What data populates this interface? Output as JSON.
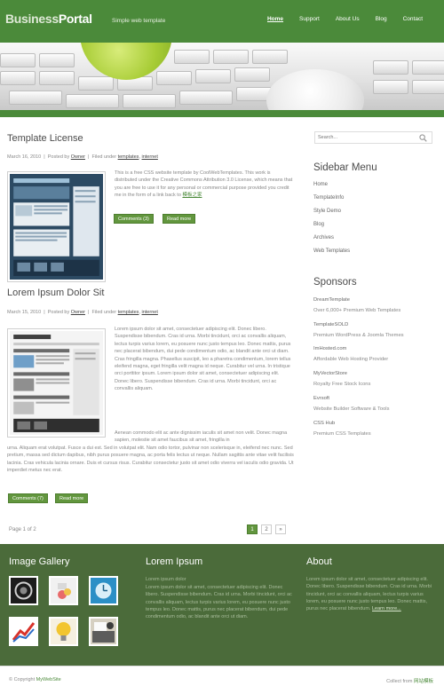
{
  "header": {
    "logo_part1": "Business",
    "logo_part2": "Portal",
    "tagline": "Simple web template",
    "nav": [
      "Home",
      "Support",
      "About Us",
      "Blog",
      "Contact"
    ]
  },
  "posts": [
    {
      "title": "Template License",
      "meta_date": "March 16, 2010",
      "meta_posted_by": "Posted by",
      "meta_author": "Owner",
      "meta_filed": "Filed under",
      "meta_tag1": "templates",
      "meta_tag2": "internet",
      "text": "This is a free CSS website template by CoolWebTemplates. This work is distributed under the Creative Commons Attribution 3.0 License, which means that you are free to use it for any personal or commercial purpose provided you credit me in the form of a link back to",
      "text_link": "模板之家",
      "comments_label": "Comments (3)",
      "readmore_label": "Read more"
    },
    {
      "title": "Lorem Ipsum Dolor Sit",
      "meta_date": "March 15, 2010",
      "meta_posted_by": "Posted by",
      "meta_author": "Owner",
      "meta_filed": "Filed under",
      "meta_tag1": "templates",
      "meta_tag2": "internet",
      "para1": "Lorem ipsum dolor sit amet, consectetuer adipiscing elit. Donec libero. Suspendisse bibendum. Cras id urna. Morbi tincidunt, orci ac convallis aliquam, lectus turpis varius lorem, eu posuere nunc justo tempus leo. Donec mattis, purus nec placerat bibendum, dui pede condimentum odio, ac blandit ante orci ut diam. Cras fringilla magna. Phasellus suscipit, leo a pharetra condimentum, lorem tellus eleifend magna, eget fringilla velit magna id neque. Curabitur vel urna. In tristique orci porttitor ipsum. Lorem ipsum dolor sit amet, consectetuer adipiscing elit. Donec libero. Suspendisse bibendum. Cras id urna. Morbi tincidunt, orci ac convallis aliquam.",
      "para2_a": "Aenean commodo elit ac ante dignissim iaculis sit amet non velit. Donec magna sapien, molestie sit amet faucibus sit amet, fringilla in",
      "para2_b": "urna. Aliquam erat volutpat. Fusce a dui est. Sed in volutpat elit. Nam odio tortor, pulvinar non scelerisque in, eleifend nec nunc. Sed pretium, massa sed dictum dapibus, nibh purus posuere magna, ac porta felis lectus ut neque. Nullam sagittis ante vitae velit facilisis lacinia. Cras vehicula lacinia ornare. Duis et cursus risus. Curabitur consectetur justo sit amet odio viverra vel iaculis odio gravida. Ut imperdiet metus nec erat.",
      "comments_label": "Comments (7)",
      "readmore_label": "Read more"
    }
  ],
  "pagination": {
    "page_of": "Page 1 of 2",
    "pages": [
      "1",
      "2"
    ],
    "next": "»"
  },
  "sidebar": {
    "search_placeholder": "Search...",
    "menu_heading": "Sidebar Menu",
    "menu": [
      "Home",
      "TemplateInfo",
      "Style Demo",
      "Blog",
      "Archives",
      "Web Templates"
    ],
    "sponsors_heading": "Sponsors",
    "sponsors": [
      {
        "name": "DreamTemplate",
        "desc": "Over 6,000+ Premium Web Templates"
      },
      {
        "name": "TemplateSOLD",
        "desc": "Premium WordPress & Joomla Themes"
      },
      {
        "name": "ImHosted.com",
        "desc": "Affordable Web Hosting Provider"
      },
      {
        "name": "MyVectorStore",
        "desc": "Royalty Free Stock Icons"
      },
      {
        "name": "Evrsoft",
        "desc": "Website Builder Software & Tools"
      },
      {
        "name": "CSS Hub",
        "desc": "Premium CSS Templates"
      }
    ]
  },
  "footer": {
    "gallery_heading": "Image Gallery",
    "lorem_heading": "Lorem Ipsum",
    "lorem_sub": "Lorem ipsum dolor",
    "lorem_text": "Lorem ipsum dolor sit amet, consectetuer adipiscing elit. Donec libero. Suspendisse bibendum. Cras id urna. Morbi tincidunt, orci ac convallis aliquam, lectus turpis varius lorem, eu posuere nunc justo tempus leo. Donec mattis, purus nec placerat bibendum, dui pede condimentum odio, ac blandit ante orci ut diam.",
    "about_heading": "About",
    "about_text": "Lorem ipsum dolor sit amet, consectetuer adipiscing elit. Donec libero. Suspendisse bibendum. Cras id urna. Morbi tincidunt, orci ac convallis aliquam, lectus turpis varius lorem, eu posuere nunc justo tempus leo. Donec mattis, purus nec placerat bibendum.",
    "about_link": "Learn more...",
    "copyright_prefix": "© Copyright",
    "copyright_site": "MyWebSite",
    "credit_prefix": "Collect from",
    "credit_link": "网站模板"
  },
  "colors": {
    "brand_green": "#4b8a3a",
    "button_green": "#62963e",
    "footer_green": "#4b6b3a"
  },
  "icons": [
    "search-icon"
  ]
}
